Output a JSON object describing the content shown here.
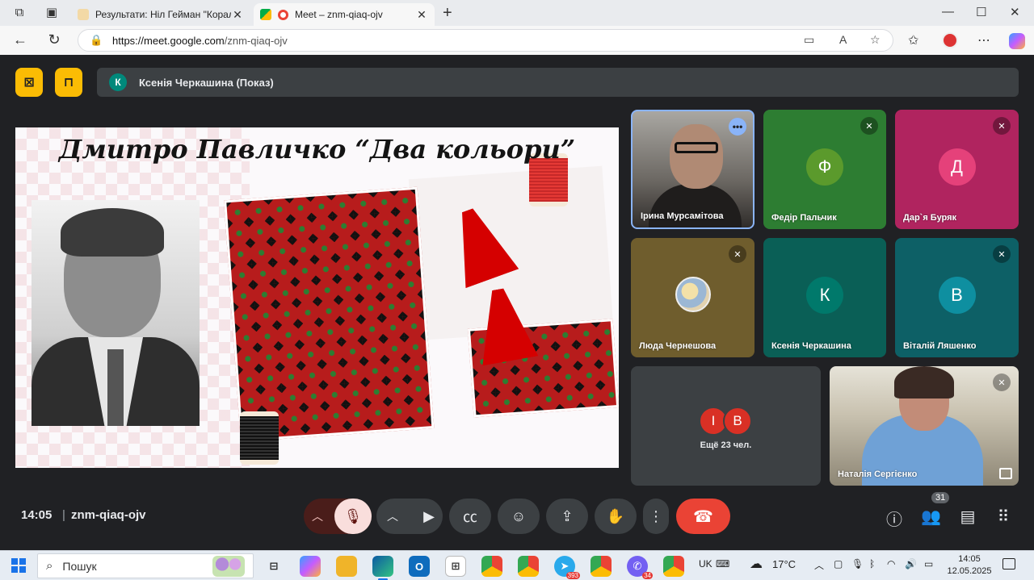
{
  "browser": {
    "tabs": [
      {
        "title": "Результати: Ніл Гейман \"Коралін",
        "close": "✕"
      },
      {
        "title": "Meet – znm-qiaq-ojv",
        "close": "✕"
      }
    ],
    "url_host": "https://meet.google.com",
    "url_path": "/znm-qiaq-ojv",
    "icons": {
      "new_tab": "+",
      "back": "←",
      "reload": "↻",
      "lock": "🔒",
      "minimize": "—",
      "maximize": "☐",
      "close": "✕",
      "menu": "⋯"
    }
  },
  "meet": {
    "presenting_initial": "К",
    "presenting_text": "Ксенія Черкашина (Показ)",
    "slide_title": "Дмитро Павличко “Два кольори”",
    "participants": [
      {
        "name": "Ірина Мурсамітова",
        "initial": "",
        "color": "#777"
      },
      {
        "name": "Федір Пальчик",
        "initial": "Ф",
        "color": "#5b9a2c"
      },
      {
        "name": "Дар`я Буряк",
        "initial": "Д",
        "color": "#e5417a"
      },
      {
        "name": "Люда Чернешова",
        "initial": "",
        "color": "#6f5d2d"
      },
      {
        "name": "Ксенія Черкашина",
        "initial": "К",
        "color": "#00796b"
      },
      {
        "name": "Віталій Ляшенко",
        "initial": "В",
        "color": "#0e8fa0"
      },
      {
        "name": "Наталія Сергієнко",
        "initial": "",
        "color": "#8d8675"
      }
    ],
    "more_tile": {
      "avatars": [
        "І",
        "В"
      ],
      "avatar_colors": [
        "#d93025",
        "#d93025"
      ],
      "label": "Ещё 23 чел."
    },
    "time": "14:05",
    "separator": "|",
    "meeting_code": "znm-qiaq-ojv",
    "participant_count": "31",
    "accent": "#8ab4f8",
    "end_color": "#ea4335"
  },
  "taskbar": {
    "search_placeholder": "Пошук",
    "lang": "UK",
    "weather": "17°C",
    "clock_time": "14:05",
    "clock_date": "12.05.2025",
    "telegram_count": "393",
    "viber_count": "34"
  }
}
